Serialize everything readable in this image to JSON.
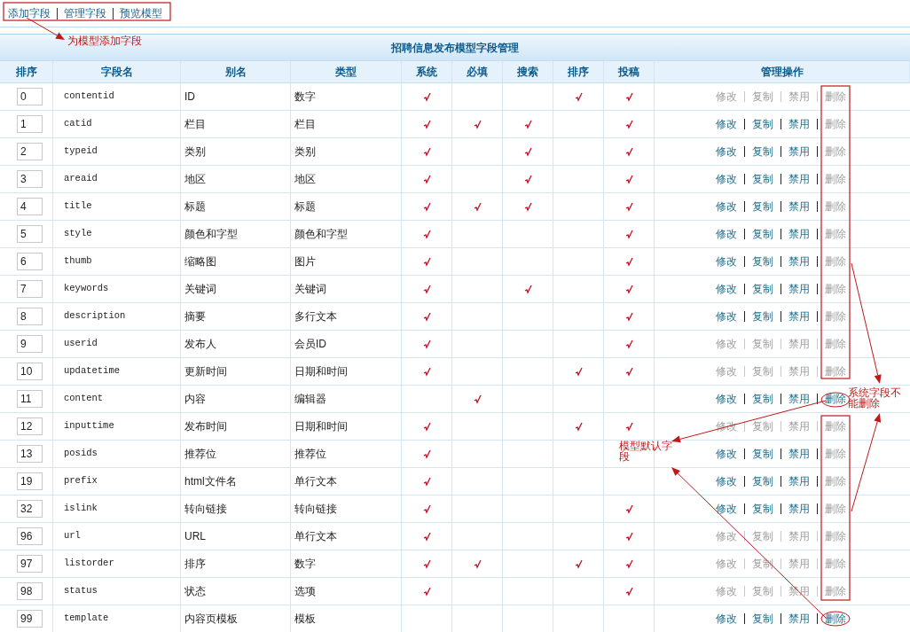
{
  "nav_links": [
    {
      "label": "添加字段"
    },
    {
      "label": "管理字段"
    },
    {
      "label": "预览模型"
    }
  ],
  "table": {
    "title": "招聘信息发布模型字段管理",
    "columns": [
      "排序",
      "字段名",
      "别名",
      "类型",
      "系统",
      "必填",
      "搜索",
      "排序",
      "投稿",
      "管理操作"
    ],
    "rows": [
      {
        "order": "0",
        "field": "contentid",
        "alias": "ID",
        "type": "数字",
        "system": true,
        "required": false,
        "search": false,
        "sortable": true,
        "contribute": true,
        "actions": [
          {
            "label": "修改",
            "disabled": true
          },
          {
            "label": "复制",
            "disabled": true
          },
          {
            "label": "禁用",
            "disabled": true
          },
          {
            "label": "删除",
            "disabled": true
          }
        ]
      },
      {
        "order": "1",
        "field": "catid",
        "alias": "栏目",
        "type": "栏目",
        "system": true,
        "required": true,
        "search": true,
        "sortable": false,
        "contribute": true,
        "actions": [
          {
            "label": "修改",
            "disabled": false
          },
          {
            "label": "复制",
            "disabled": false
          },
          {
            "label": "禁用",
            "disabled": false
          },
          {
            "label": "删除",
            "disabled": true
          }
        ]
      },
      {
        "order": "2",
        "field": "typeid",
        "alias": "类别",
        "type": "类别",
        "system": true,
        "required": false,
        "search": true,
        "sortable": false,
        "contribute": true,
        "actions": [
          {
            "label": "修改",
            "disabled": false
          },
          {
            "label": "复制",
            "disabled": false
          },
          {
            "label": "禁用",
            "disabled": false
          },
          {
            "label": "删除",
            "disabled": true
          }
        ]
      },
      {
        "order": "3",
        "field": "areaid",
        "alias": "地区",
        "type": "地区",
        "system": true,
        "required": false,
        "search": true,
        "sortable": false,
        "contribute": true,
        "actions": [
          {
            "label": "修改",
            "disabled": false
          },
          {
            "label": "复制",
            "disabled": false
          },
          {
            "label": "禁用",
            "disabled": false
          },
          {
            "label": "删除",
            "disabled": true
          }
        ]
      },
      {
        "order": "4",
        "field": "title",
        "alias": "标题",
        "type": "标题",
        "system": true,
        "required": true,
        "search": true,
        "sortable": false,
        "contribute": true,
        "actions": [
          {
            "label": "修改",
            "disabled": false
          },
          {
            "label": "复制",
            "disabled": false
          },
          {
            "label": "禁用",
            "disabled": false
          },
          {
            "label": "删除",
            "disabled": true
          }
        ]
      },
      {
        "order": "5",
        "field": "style",
        "alias": "颜色和字型",
        "type": "颜色和字型",
        "system": true,
        "required": false,
        "search": false,
        "sortable": false,
        "contribute": true,
        "actions": [
          {
            "label": "修改",
            "disabled": false
          },
          {
            "label": "复制",
            "disabled": false
          },
          {
            "label": "禁用",
            "disabled": false
          },
          {
            "label": "删除",
            "disabled": true
          }
        ]
      },
      {
        "order": "6",
        "field": "thumb",
        "alias": "缩略图",
        "type": "图片",
        "system": true,
        "required": false,
        "search": false,
        "sortable": false,
        "contribute": true,
        "actions": [
          {
            "label": "修改",
            "disabled": false
          },
          {
            "label": "复制",
            "disabled": false
          },
          {
            "label": "禁用",
            "disabled": false
          },
          {
            "label": "删除",
            "disabled": true
          }
        ]
      },
      {
        "order": "7",
        "field": "keywords",
        "alias": "关键词",
        "type": "关键词",
        "system": true,
        "required": false,
        "search": true,
        "sortable": false,
        "contribute": true,
        "actions": [
          {
            "label": "修改",
            "disabled": false
          },
          {
            "label": "复制",
            "disabled": false
          },
          {
            "label": "禁用",
            "disabled": false
          },
          {
            "label": "删除",
            "disabled": true
          }
        ]
      },
      {
        "order": "8",
        "field": "description",
        "alias": "摘要",
        "type": "多行文本",
        "system": true,
        "required": false,
        "search": false,
        "sortable": false,
        "contribute": true,
        "actions": [
          {
            "label": "修改",
            "disabled": false
          },
          {
            "label": "复制",
            "disabled": false
          },
          {
            "label": "禁用",
            "disabled": false
          },
          {
            "label": "删除",
            "disabled": true
          }
        ]
      },
      {
        "order": "9",
        "field": "userid",
        "alias": "发布人",
        "type": "会员ID",
        "system": true,
        "required": false,
        "search": false,
        "sortable": false,
        "contribute": true,
        "actions": [
          {
            "label": "修改",
            "disabled": true
          },
          {
            "label": "复制",
            "disabled": true
          },
          {
            "label": "禁用",
            "disabled": true
          },
          {
            "label": "删除",
            "disabled": true
          }
        ]
      },
      {
        "order": "10",
        "field": "updatetime",
        "alias": "更新时间",
        "type": "日期和时间",
        "system": true,
        "required": false,
        "search": false,
        "sortable": true,
        "contribute": true,
        "actions": [
          {
            "label": "修改",
            "disabled": true
          },
          {
            "label": "复制",
            "disabled": true
          },
          {
            "label": "禁用",
            "disabled": true
          },
          {
            "label": "删除",
            "disabled": true
          }
        ]
      },
      {
        "order": "11",
        "field": "content",
        "alias": "内容",
        "type": "编辑器",
        "system": false,
        "required": true,
        "search": false,
        "sortable": false,
        "contribute": false,
        "actions": [
          {
            "label": "修改",
            "disabled": false
          },
          {
            "label": "复制",
            "disabled": false
          },
          {
            "label": "禁用",
            "disabled": false
          },
          {
            "label": "删除",
            "disabled": false
          }
        ]
      },
      {
        "order": "12",
        "field": "inputtime",
        "alias": "发布时间",
        "type": "日期和时间",
        "system": true,
        "required": false,
        "search": false,
        "sortable": true,
        "contribute": true,
        "actions": [
          {
            "label": "修改",
            "disabled": true
          },
          {
            "label": "复制",
            "disabled": true
          },
          {
            "label": "禁用",
            "disabled": true
          },
          {
            "label": "删除",
            "disabled": true
          }
        ]
      },
      {
        "order": "13",
        "field": "posids",
        "alias": "推荐位",
        "type": "推荐位",
        "system": true,
        "required": false,
        "search": false,
        "sortable": false,
        "contribute": false,
        "actions": [
          {
            "label": "修改",
            "disabled": false
          },
          {
            "label": "复制",
            "disabled": false
          },
          {
            "label": "禁用",
            "disabled": false
          },
          {
            "label": "删除",
            "disabled": true
          }
        ]
      },
      {
        "order": "19",
        "field": "prefix",
        "alias": "html文件名",
        "type": "单行文本",
        "system": true,
        "required": false,
        "search": false,
        "sortable": false,
        "contribute": false,
        "actions": [
          {
            "label": "修改",
            "disabled": false
          },
          {
            "label": "复制",
            "disabled": false
          },
          {
            "label": "禁用",
            "disabled": false
          },
          {
            "label": "删除",
            "disabled": true
          }
        ]
      },
      {
        "order": "32",
        "field": "islink",
        "alias": "转向链接",
        "type": "转向链接",
        "system": true,
        "required": false,
        "search": false,
        "sortable": false,
        "contribute": true,
        "actions": [
          {
            "label": "修改",
            "disabled": false
          },
          {
            "label": "复制",
            "disabled": false
          },
          {
            "label": "禁用",
            "disabled": false
          },
          {
            "label": "删除",
            "disabled": true
          }
        ]
      },
      {
        "order": "96",
        "field": "url",
        "alias": "URL",
        "type": "单行文本",
        "system": true,
        "required": false,
        "search": false,
        "sortable": false,
        "contribute": true,
        "actions": [
          {
            "label": "修改",
            "disabled": true
          },
          {
            "label": "复制",
            "disabled": true
          },
          {
            "label": "禁用",
            "disabled": true
          },
          {
            "label": "删除",
            "disabled": true
          }
        ]
      },
      {
        "order": "97",
        "field": "listorder",
        "alias": "排序",
        "type": "数字",
        "system": true,
        "required": true,
        "search": false,
        "sortable": true,
        "contribute": true,
        "actions": [
          {
            "label": "修改",
            "disabled": true
          },
          {
            "label": "复制",
            "disabled": true
          },
          {
            "label": "禁用",
            "disabled": true
          },
          {
            "label": "删除",
            "disabled": true
          }
        ]
      },
      {
        "order": "98",
        "field": "status",
        "alias": "状态",
        "type": "选项",
        "system": true,
        "required": false,
        "search": false,
        "sortable": false,
        "contribute": true,
        "actions": [
          {
            "label": "修改",
            "disabled": true
          },
          {
            "label": "复制",
            "disabled": true
          },
          {
            "label": "禁用",
            "disabled": true
          },
          {
            "label": "删除",
            "disabled": true
          }
        ]
      },
      {
        "order": "99",
        "field": "template",
        "alias": "内容页模板",
        "type": "模板",
        "system": false,
        "required": false,
        "search": false,
        "sortable": false,
        "contribute": false,
        "actions": [
          {
            "label": "修改",
            "disabled": false
          },
          {
            "label": "复制",
            "disabled": false
          },
          {
            "label": "禁用",
            "disabled": false
          },
          {
            "label": "删除",
            "disabled": false
          }
        ]
      }
    ]
  },
  "annotations": [
    {
      "text": "为模型添加字段"
    },
    {
      "text": "系统字段不能删除"
    },
    {
      "text": "模型默认字段"
    }
  ]
}
